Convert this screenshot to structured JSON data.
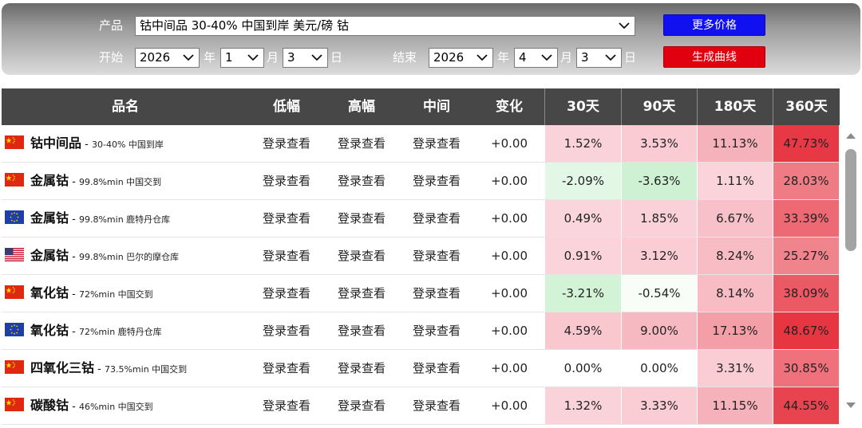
{
  "filters": {
    "product_label": "产品",
    "product_value": "钴中间品 30-40% 中国到岸 美元/磅 钴",
    "start_label": "开始",
    "end_label": "结束",
    "start": {
      "year": "2026",
      "year_unit": "年",
      "month": "1",
      "month_unit": "月",
      "day": "3",
      "day_unit": "日"
    },
    "end": {
      "year": "2026",
      "year_unit": "年",
      "month": "4",
      "month_unit": "月",
      "day": "3",
      "day_unit": "日"
    },
    "more_prices_button": "更多价格",
    "generate_curve_button": "生成曲线"
  },
  "colors": {
    "blue_button": "#1010f0",
    "red_button": "#e0000f",
    "header_bg": "#474747"
  },
  "table": {
    "headers": [
      "品名",
      "低幅",
      "高幅",
      "中间",
      "变化",
      "30天",
      "90天",
      "180天",
      "360天"
    ],
    "rows": [
      {
        "flag": "cn-flag-icon",
        "name": "钴中间品",
        "spec": "30-40% 中国到岸",
        "low": "登录查看",
        "high": "登录查看",
        "mid": "登录查看",
        "change": "+0.00",
        "d30": "1.52%",
        "d90": "3.53%",
        "d180": "11.13%",
        "d360": "47.73%"
      },
      {
        "flag": "cn-flag-icon",
        "name": "金属钴",
        "spec": "99.8%min 中国交到",
        "low": "登录查看",
        "high": "登录查看",
        "mid": "登录查看",
        "change": "+0.00",
        "d30": "-2.09%",
        "d90": "-3.63%",
        "d180": "1.11%",
        "d360": "28.03%"
      },
      {
        "flag": "eu-flag-icon",
        "name": "金属钴",
        "spec": "99.8%min 鹿特丹仓库",
        "low": "登录查看",
        "high": "登录查看",
        "mid": "登录查看",
        "change": "+0.00",
        "d30": "0.49%",
        "d90": "1.85%",
        "d180": "6.67%",
        "d360": "33.39%"
      },
      {
        "flag": "us-flag-icon",
        "name": "金属钴",
        "spec": "99.8%min 巴尔的摩仓库",
        "low": "登录查看",
        "high": "登录查看",
        "mid": "登录查看",
        "change": "+0.00",
        "d30": "0.91%",
        "d90": "3.12%",
        "d180": "8.24%",
        "d360": "25.27%"
      },
      {
        "flag": "cn-flag-icon",
        "name": "氧化钴",
        "spec": "72%min 中国交到",
        "low": "登录查看",
        "high": "登录查看",
        "mid": "登录查看",
        "change": "+0.00",
        "d30": "-3.21%",
        "d90": "-0.54%",
        "d180": "8.14%",
        "d360": "38.09%"
      },
      {
        "flag": "eu-flag-icon",
        "name": "氧化钴",
        "spec": "72%min 鹿特丹仓库",
        "low": "登录查看",
        "high": "登录查看",
        "mid": "登录查看",
        "change": "+0.00",
        "d30": "4.59%",
        "d90": "9.00%",
        "d180": "17.13%",
        "d360": "48.67%"
      },
      {
        "flag": "cn-flag-icon",
        "name": "四氧化三钴",
        "spec": "73.5%min 中国交到",
        "low": "登录查看",
        "high": "登录查看",
        "mid": "登录查看",
        "change": "+0.00",
        "d30": "0.00%",
        "d90": "0.00%",
        "d180": "3.31%",
        "d360": "30.85%"
      },
      {
        "flag": "cn-flag-icon",
        "name": "碳酸钴",
        "spec": "46%min 中国交到",
        "low": "登录查看",
        "high": "登录查看",
        "mid": "登录查看",
        "change": "+0.00",
        "d30": "1.32%",
        "d90": "3.33%",
        "d180": "11.15%",
        "d360": "44.55%"
      }
    ]
  }
}
